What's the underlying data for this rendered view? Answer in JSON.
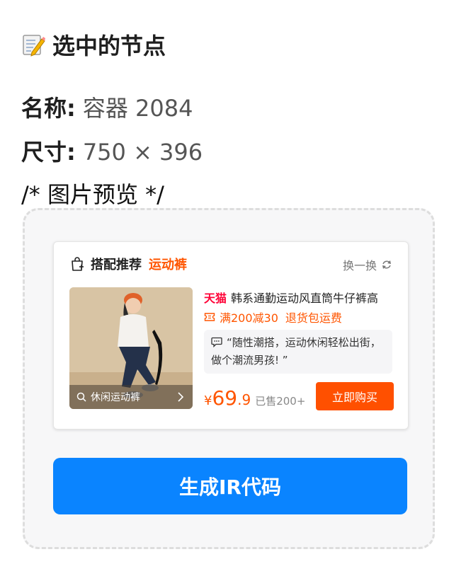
{
  "header": {
    "icon": "memo-icon",
    "title": "选中的节点"
  },
  "node": {
    "name_label": "名称:",
    "name_value": "容器 2084",
    "size_label": "尺寸:",
    "size_value": "750 × 396"
  },
  "preview_comment": "/* 图片预览 */",
  "card": {
    "title": "搭配推荐",
    "category": "运动裤",
    "swap_label": "换一换",
    "thumb_search": "休闲运动裤",
    "brand": "天猫",
    "product_title": "韩系通勤运动风直筒牛仔裤高",
    "promo_discount": "满200减30",
    "promo_return": "退货包运费",
    "quote": "“随性潮搭，运动休闲轻松出街，做个潮流男孩! ”",
    "price_currency": "¥",
    "price_int": "69",
    "price_dec": ".9",
    "sold": "已售200+",
    "buy_label": "立即购买"
  },
  "generate_button": "生成IR代码",
  "colors": {
    "accent": "#0a84ff",
    "orange": "#ff5500",
    "tmall": "#ff0036"
  }
}
